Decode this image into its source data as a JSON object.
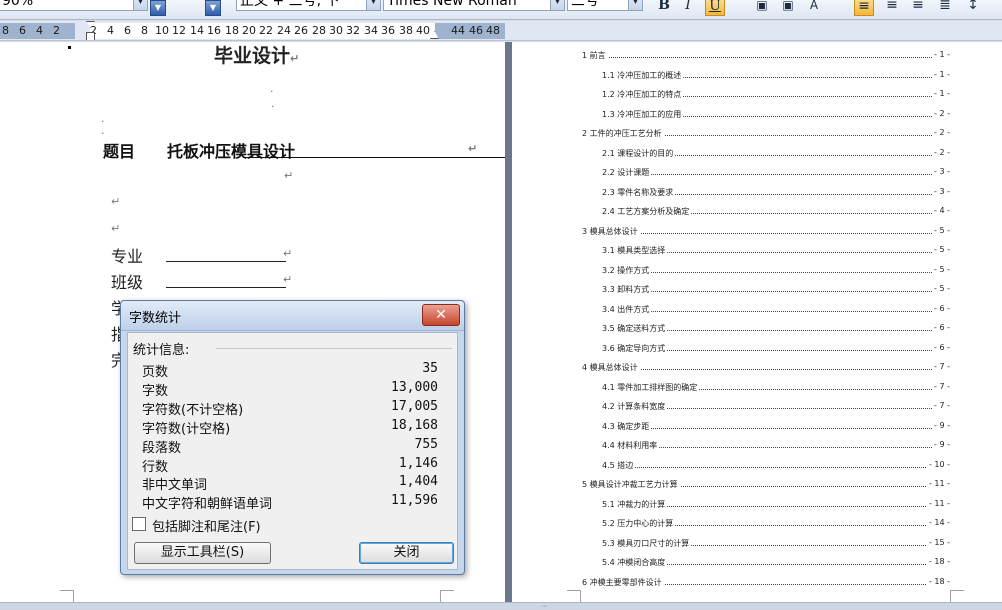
{
  "toolbar": {
    "zoom": "90%",
    "style": "正文 + 三号, 下",
    "font": "Times New Roman",
    "font_size": "三号",
    "bold": "B",
    "italic": "I",
    "underline": "U"
  },
  "ruler": {
    "ticks": [
      "8",
      "6",
      "4",
      "2",
      "2",
      "4",
      "6",
      "8",
      "10",
      "12",
      "14",
      "16",
      "18",
      "20",
      "22",
      "24",
      "26",
      "28",
      "30",
      "32",
      "34",
      "36",
      "38",
      "40",
      "44",
      "46",
      "48"
    ]
  },
  "document": {
    "title": "毕业设计",
    "topic_label": "题目",
    "topic_value": "托板冲压模具设计",
    "fields": [
      "专业",
      "班级",
      "学号",
      "指导",
      "完成"
    ],
    "return_mark": "↵"
  },
  "dialog": {
    "title": "字数统计",
    "close_glyph": "✕",
    "stats_header": "统计信息:",
    "stats": [
      {
        "label": "页数",
        "value": "35"
      },
      {
        "label": "字数",
        "value": "13,000"
      },
      {
        "label": "字符数(不计空格)",
        "value": "17,005"
      },
      {
        "label": "字符数(计空格)",
        "value": "18,168"
      },
      {
        "label": "段落数",
        "value": "755"
      },
      {
        "label": "行数",
        "value": "1,146"
      },
      {
        "label": "非中文单词",
        "value": "1,404"
      },
      {
        "label": "中文字符和朝鲜语单词",
        "value": "11,596"
      }
    ],
    "checkbox_label": "包括脚注和尾注(F)",
    "button_toolbar": "显示工具栏(S)",
    "button_close": "关闭"
  },
  "toc": [
    {
      "text": "1 前言",
      "page": "- 1 -",
      "level": 1
    },
    {
      "text": "1.1 冷冲压加工的概述",
      "page": "- 1 -",
      "level": 2
    },
    {
      "text": "1.2 冷冲压加工的特点",
      "page": "- 1 -",
      "level": 2
    },
    {
      "text": "1.3 冷冲压加工的应用",
      "page": "- 2 -",
      "level": 2
    },
    {
      "text": "2 工件的冲压工艺分析",
      "page": "- 2 -",
      "level": 1
    },
    {
      "text": "2.1 课程设计的目的",
      "page": "- 2 -",
      "level": 2
    },
    {
      "text": "2.2 设计课题",
      "page": "- 3 -",
      "level": 2
    },
    {
      "text": "2.3 零件名称及要求",
      "page": "- 3 -",
      "level": 2
    },
    {
      "text": "2.4 工艺方案分析及确定",
      "page": "- 4 -",
      "level": 2
    },
    {
      "text": "3 模具总体设计",
      "page": "- 5 -",
      "level": 1
    },
    {
      "text": "3.1 模具类型选择",
      "page": "- 5 -",
      "level": 2
    },
    {
      "text": "3.2 操作方式",
      "page": "- 5 -",
      "level": 2
    },
    {
      "text": "3.3 卸料方式",
      "page": "- 5 -",
      "level": 2
    },
    {
      "text": "3.4 出件方式",
      "page": "- 6 -",
      "level": 2
    },
    {
      "text": "3.5 确定送料方式",
      "page": "- 6 -",
      "level": 2
    },
    {
      "text": "3.6 确定导向方式",
      "page": "- 6 -",
      "level": 2
    },
    {
      "text": "4 模具总体设计",
      "page": "- 7 -",
      "level": 1
    },
    {
      "text": "4.1 零件加工排样图的确定",
      "page": "- 7 -",
      "level": 2
    },
    {
      "text": "4.2 计算条料宽度",
      "page": "- 7 -",
      "level": 2
    },
    {
      "text": "4.3 确定步距",
      "page": "- 9 -",
      "level": 2
    },
    {
      "text": "4.4 材料利用率",
      "page": "- 9 -",
      "level": 2
    },
    {
      "text": "4.5 搭边",
      "page": "- 10 -",
      "level": 2
    },
    {
      "text": "5 模具设计冲裁工艺力计算",
      "page": "- 11 -",
      "level": 1
    },
    {
      "text": "5.1 冲裁力的计算",
      "page": "- 11 -",
      "level": 2
    },
    {
      "text": "5.2 压力中心的计算",
      "page": "- 14 -",
      "level": 2
    },
    {
      "text": "5.3 模具刃口尺寸的计算",
      "page": "- 15 -",
      "level": 2
    },
    {
      "text": "5.4 冲模闭合高度",
      "page": "- 18 -",
      "level": 2
    },
    {
      "text": "6 冲模主要零部件设计",
      "page": "- 18 -",
      "level": 1
    }
  ],
  "colors": {
    "dialog_bg": "#c6d7ec",
    "close_red": "#c8452c",
    "page_bg": "#ffffff",
    "workspace": "#8e9aab"
  }
}
